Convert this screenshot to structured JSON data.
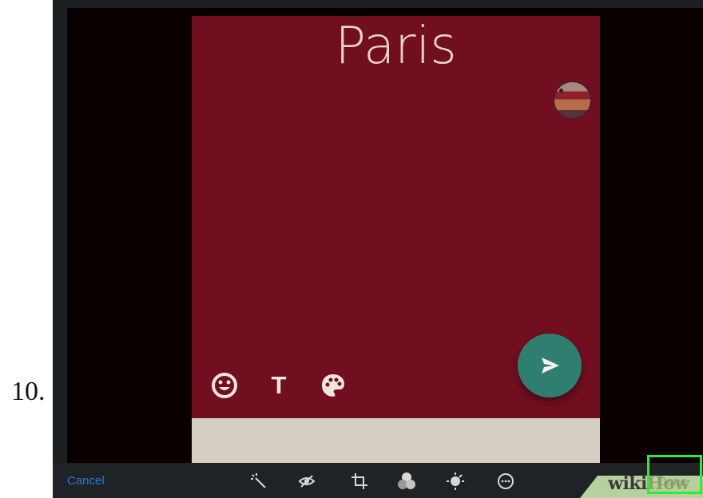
{
  "step": {
    "number": "10."
  },
  "status_editor": {
    "text": "Paris",
    "background_color": "#710e1f",
    "text_color": "#e7d4c3",
    "caption_bar_color": "#d4cec5",
    "avatar": {
      "icon": "contact-photo"
    },
    "tools": [
      {
        "name": "emoji",
        "icon": "smiley-icon"
      },
      {
        "name": "text",
        "label": "T",
        "icon": "text-icon"
      },
      {
        "name": "color",
        "icon": "palette-icon"
      }
    ],
    "send_button": {
      "icon": "send-icon",
      "color": "#2e7f70"
    }
  },
  "bottom_toolbar": {
    "cancel_label": "Cancel",
    "done_label": "Done",
    "icons": [
      "magic-wand-icon",
      "hidden-eye-icon",
      "crop-icon",
      "filters-icon",
      "adjust-icon",
      "more-icon"
    ],
    "accent_color": "#2d79d9"
  },
  "watermark": {
    "wiki": "wiki",
    "how": "How",
    "accent_color": "#8ba65d"
  },
  "highlight": {
    "color": "#30ea36",
    "target": "done-button"
  }
}
